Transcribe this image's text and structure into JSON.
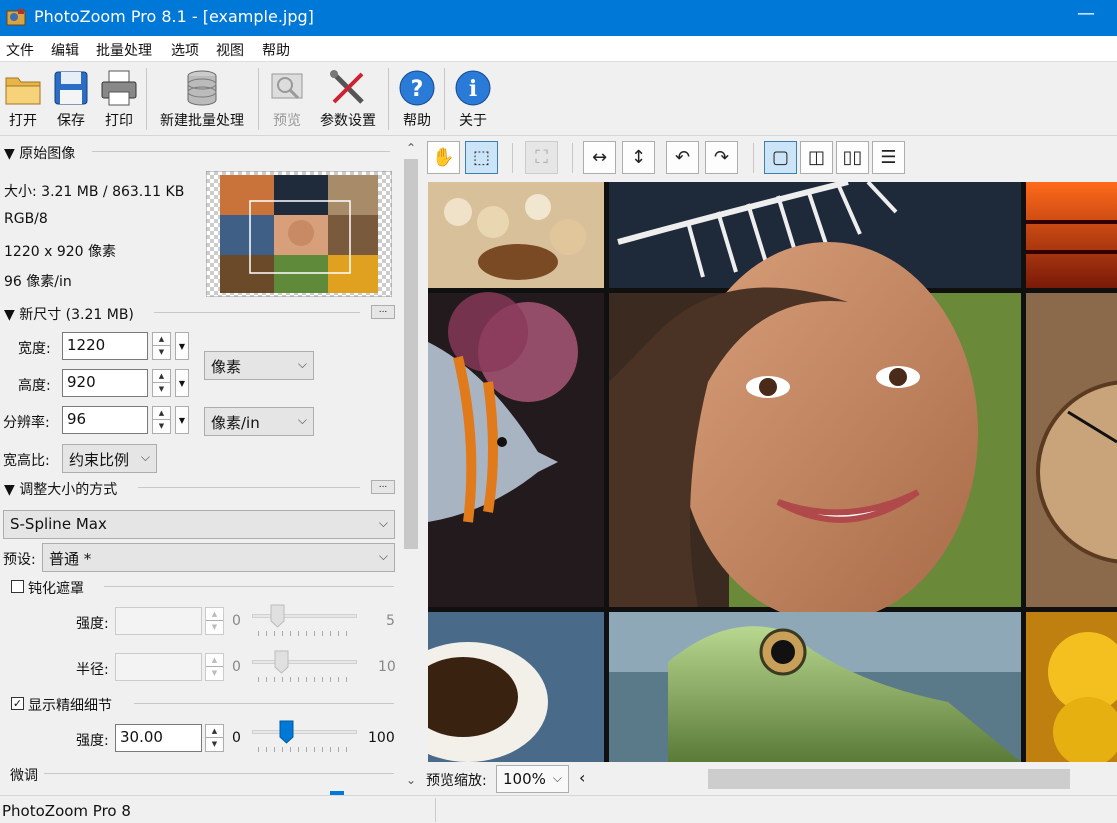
{
  "window": {
    "title": "PhotoZoom Pro 8.1 - [example.jpg]",
    "minimize_icon": "minimize-icon",
    "accent": "#0078d7"
  },
  "menu": [
    "文件",
    "编辑",
    "批量处理",
    "选项",
    "视图",
    "帮助"
  ],
  "toolbar": {
    "open": "打开",
    "save": "保存",
    "print": "打印",
    "new_batch": "新建批量处理",
    "preview": "预览",
    "settings": "参数设置",
    "help": "帮助",
    "about": "关于"
  },
  "original": {
    "header": "▼ 原始图像",
    "size": "大小: 3.21 MB / 863.11 KB",
    "mode": "RGB/8",
    "dimensions": "1220 x 920 像素",
    "dpi": "96 像素/in"
  },
  "new_size": {
    "header": "▼ 新尺寸 (3.21 MB)",
    "more_button": "...",
    "width_label": "宽度:",
    "width_value": "1220",
    "height_label": "高度:",
    "height_value": "920",
    "unit_select": "像素",
    "resolution_label": "分辨率:",
    "resolution_value": "96",
    "resolution_unit": "像素/in",
    "aspect_label": "宽高比:",
    "aspect_value": "约束比例"
  },
  "resize_method": {
    "header": "▼ 调整大小的方式",
    "more_button": "...",
    "method": "S-Spline Max",
    "preset_label": "预设:",
    "preset_value": "普通 *"
  },
  "unsharp": {
    "label": "钝化遮罩",
    "checked": false,
    "strength_label": "强度:",
    "strength_min": "0",
    "strength_max": "5",
    "radius_label": "半径:",
    "radius_min": "0",
    "radius_max": "10"
  },
  "fine_detail": {
    "label": "显示精细细节",
    "checked": true,
    "strength_label": "强度:",
    "strength_value": "30.00",
    "min": "0",
    "max": "100",
    "level": 0.3
  },
  "tweak": {
    "header": "微调"
  },
  "view_toolbar": {
    "hand": "hand-icon",
    "select": "select-icon",
    "crop": "crop-icon",
    "fit_width": "fit-width-icon",
    "fit_height": "fit-height-icon",
    "rotate_left": "rotate-left-icon",
    "rotate_right": "rotate-right-icon",
    "single": "single-view-icon",
    "split": "split-view-icon",
    "side_by_side": "side-by-side-icon",
    "stacked": "stacked-view-icon"
  },
  "bottom": {
    "zoom_label": "预览缩放:",
    "zoom_value": "100%"
  },
  "status": {
    "text": "PhotoZoom Pro 8"
  }
}
